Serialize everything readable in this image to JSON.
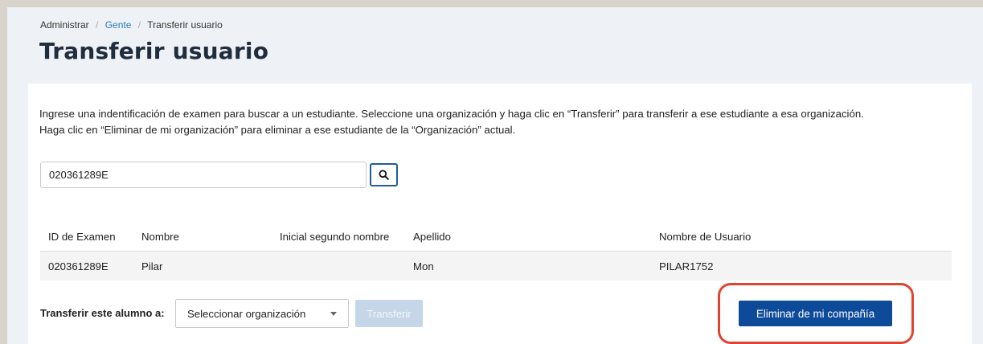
{
  "breadcrumb": {
    "root": "Administrar",
    "separator": "/",
    "people": "Gente",
    "current": "Transferir usuario"
  },
  "page": {
    "title": "Transferir usuario"
  },
  "instructions": {
    "line1": "Ingrese una indentificación de examen para buscar a un estudiante. Seleccione una organización y haga clic en “Transferir” para transferir a ese estudiante a esa organización.",
    "line2": "Haga clic en “Eliminar de mi organización” para eliminar a ese estudiante de la “Organización” actual."
  },
  "search": {
    "value": "020361289E",
    "icon": "search-icon"
  },
  "table": {
    "headers": [
      "ID de Examen",
      "Nombre",
      "Inicial segundo nombre",
      "Apellido",
      "Nombre de Usuario"
    ],
    "rows": [
      [
        "020361289E",
        "Pilar",
        "",
        "Mon",
        "PILAR1752"
      ]
    ]
  },
  "transfer": {
    "label": "Transferir este alumno a:",
    "select_value": "Seleccionar organización",
    "button_label": "Transferir",
    "remove_label": "Eliminar de mi compañía"
  },
  "colors": {
    "accent": "#0d4a9a",
    "highlight": "#e04431",
    "link": "#2a7ab8"
  }
}
